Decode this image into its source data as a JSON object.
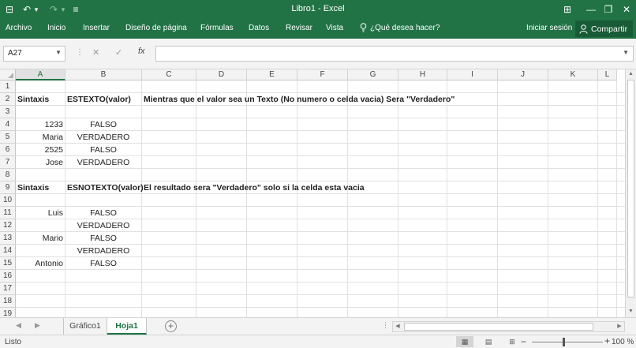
{
  "window": {
    "title": "Libro1 - Excel",
    "quick_access": [
      {
        "name": "save-icon",
        "glyph": "⊟"
      },
      {
        "name": "undo-icon",
        "glyph": "↶"
      },
      {
        "name": "undo-dropdown-icon",
        "glyph": "▾"
      },
      {
        "name": "redo-icon",
        "glyph": "↷"
      },
      {
        "name": "redo-dropdown-icon",
        "glyph": "▾"
      },
      {
        "name": "customize-toolbar-icon",
        "glyph": "≡"
      }
    ],
    "controls": [
      {
        "name": "ribbon-display-options-icon",
        "glyph": "⊞"
      },
      {
        "name": "minimize-icon",
        "glyph": "—"
      },
      {
        "name": "restore-icon",
        "glyph": "❐"
      },
      {
        "name": "close-icon",
        "glyph": "✕"
      }
    ]
  },
  "ribbon": {
    "tabs": [
      "Archivo",
      "Inicio",
      "Insertar",
      "Diseño de página",
      "Fórmulas",
      "Datos",
      "Revisar",
      "Vista"
    ],
    "tell_me": "¿Qué desea hacer?",
    "sign_in": "Iniciar sesión",
    "share": "Compartir"
  },
  "formula_bar": {
    "name_box": "A27",
    "cancel_glyph": "✕",
    "enter_glyph": "✓",
    "function_label": "fx",
    "formula": ""
  },
  "grid": {
    "columns": [
      "A",
      "B",
      "C",
      "D",
      "E",
      "F",
      "G",
      "H",
      "I",
      "J",
      "K",
      "L"
    ],
    "selected_column": "A",
    "rows": [
      "1",
      "2",
      "3",
      "4",
      "5",
      "6",
      "7",
      "8",
      "9",
      "10",
      "11",
      "12",
      "13",
      "14",
      "15",
      "16",
      "17",
      "18",
      "19"
    ],
    "cells": {
      "A2": "Sintaxis",
      "B2": "ESTEXTO(valor)",
      "C2": "Mientras que el valor sea un Texto (No numero o celda vacia) Sera \"Verdadero\"",
      "A4": "1233",
      "B4": "FALSO",
      "A5": "Maria",
      "B5": "VERDADERO",
      "A6": "2525",
      "B6": "FALSO",
      "A7": "Jose",
      "B7": "VERDADERO",
      "A9": "Sintaxis",
      "B9": "ESNOTEXTO(valor)",
      "C9": "El resultado sera \"Verdadero\" solo si la celda esta vacia",
      "A11": "Luis",
      "B11": "FALSO",
      "B12": "VERDADERO",
      "A13": "Mario",
      "B13": "FALSO",
      "B14": "VERDADERO",
      "A15": "Antonio",
      "B15": "FALSO"
    }
  },
  "sheets": {
    "tabs": [
      "Gráfico1",
      "Hoja1"
    ],
    "active": "Hoja1"
  },
  "status": {
    "ready": "Listo",
    "zoom": "100 %"
  }
}
